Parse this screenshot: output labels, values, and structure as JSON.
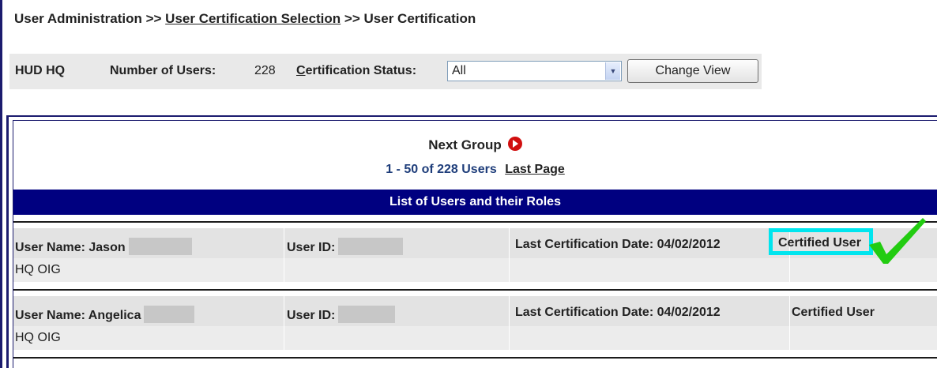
{
  "breadcrumb": {
    "part1": "User Administration",
    "sep1": ">>",
    "part2": "User Certification Selection",
    "sep2": ">>",
    "part3": "User Certification"
  },
  "filter_bar": {
    "org_label": "HUD HQ",
    "num_users_label": "Number of Users:",
    "num_users_value": "228",
    "cert_status_label": "Certification Status:",
    "cert_status_selected": "All",
    "change_view_label": "Change View"
  },
  "pagination": {
    "next_group_label": "Next Group",
    "range_text": "1 - 50 of 228 Users",
    "last_page_label": "Last Page"
  },
  "list": {
    "header": "List of Users and their Roles",
    "rows": [
      {
        "user_name": "User Name: Jason",
        "user_id": "User ID:",
        "last_cert": "Last Certification Date: 04/02/2012",
        "status": "Certified User",
        "office": "HQ OIG"
      },
      {
        "user_name": "User Name: Angelica",
        "user_id": "User ID:",
        "last_cert": "Last Certification Date: 04/02/2012",
        "status": "Certified User",
        "office": "HQ OIG"
      }
    ]
  },
  "colors": {
    "header_bg": "#000080",
    "highlight_box": "#00e5ee",
    "checkmark": "#22cc11",
    "next_icon": "#d10f0f"
  }
}
